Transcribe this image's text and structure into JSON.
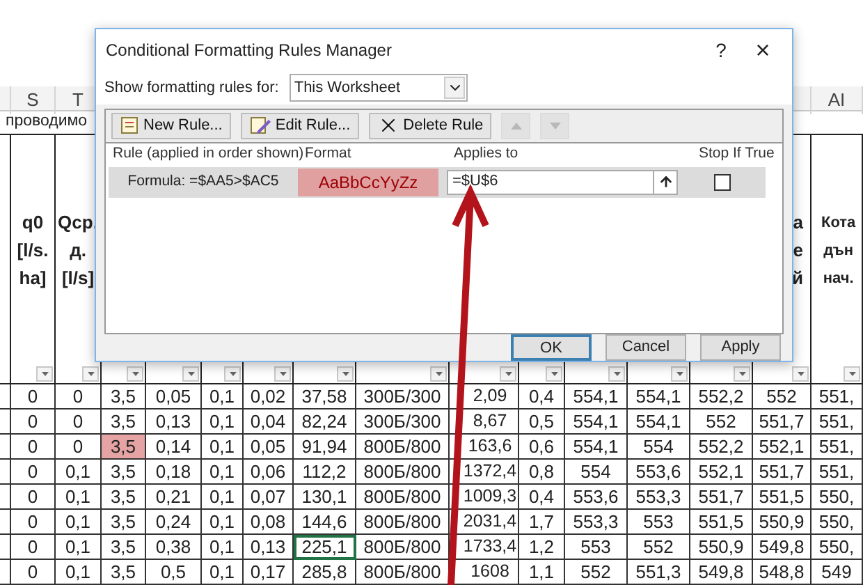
{
  "sheet": {
    "column_letters": [
      "S",
      "T",
      "AI"
    ],
    "row_2_text": "проводимо",
    "header_left": [
      [
        "q0",
        "[l/s.",
        "ha]"
      ],
      [
        "Qср.",
        "д.",
        "[l/s]"
      ]
    ],
    "header_right": [
      [
        "а",
        "е",
        "й"
      ],
      [
        "Кота",
        "дън",
        "нач."
      ]
    ],
    "rows": [
      {
        "cells": [
          "0",
          "0",
          "3,5",
          "0,05",
          "0,1",
          "0,02",
          "37,58",
          "300Б/300",
          "2,09",
          "0,4",
          "554,1",
          "554,1",
          "552,2",
          "552",
          "551,"
        ],
        "highlighted": [
          false,
          false,
          false,
          false,
          false,
          false,
          false,
          false,
          false,
          false,
          false,
          false,
          false,
          false,
          false
        ],
        "selected": [
          false,
          false,
          false,
          false,
          false,
          false,
          false,
          false,
          false,
          false,
          false,
          false,
          false,
          false,
          false
        ]
      },
      {
        "cells": [
          "0",
          "0",
          "3,5",
          "0,13",
          "0,1",
          "0,04",
          "82,24",
          "300Б/300",
          "8,67",
          "0,5",
          "554,1",
          "554,1",
          "552",
          "551,7",
          "551,"
        ],
        "highlighted": [
          false,
          false,
          false,
          false,
          false,
          false,
          false,
          false,
          false,
          false,
          false,
          false,
          false,
          false,
          false
        ],
        "selected": [
          false,
          false,
          false,
          false,
          false,
          false,
          false,
          false,
          false,
          false,
          false,
          false,
          false,
          false,
          false
        ]
      },
      {
        "cells": [
          "0",
          "0",
          "3,5",
          "0,14",
          "0,1",
          "0,05",
          "91,94",
          "800Б/800",
          "163,6",
          "0,6",
          "554,1",
          "554",
          "552,2",
          "552,1",
          "551,"
        ],
        "highlighted": [
          false,
          false,
          true,
          false,
          false,
          false,
          false,
          false,
          false,
          false,
          false,
          false,
          false,
          false,
          false
        ],
        "selected": [
          false,
          false,
          false,
          false,
          false,
          false,
          false,
          false,
          false,
          false,
          false,
          false,
          false,
          false,
          false
        ]
      },
      {
        "cells": [
          "0",
          "0,1",
          "3,5",
          "0,18",
          "0,1",
          "0,06",
          "112,2",
          "800Б/800",
          "1372,4",
          "0,8",
          "554",
          "553,6",
          "552,1",
          "551,7",
          "551,"
        ],
        "highlighted": [
          false,
          false,
          false,
          false,
          false,
          false,
          false,
          false,
          false,
          false,
          false,
          false,
          false,
          false,
          false
        ],
        "selected": [
          false,
          false,
          false,
          false,
          false,
          false,
          false,
          false,
          false,
          false,
          false,
          false,
          false,
          false,
          false
        ]
      },
      {
        "cells": [
          "0",
          "0,1",
          "3,5",
          "0,21",
          "0,1",
          "0,07",
          "130,1",
          "800Б/800",
          "1009,3",
          "0,4",
          "553,6",
          "553,3",
          "551,7",
          "551,5",
          "550,"
        ],
        "highlighted": [
          false,
          false,
          false,
          false,
          false,
          false,
          false,
          false,
          false,
          false,
          false,
          false,
          false,
          false,
          false
        ],
        "selected": [
          false,
          false,
          false,
          false,
          false,
          false,
          false,
          false,
          false,
          false,
          false,
          false,
          false,
          false,
          false
        ]
      },
      {
        "cells": [
          "0",
          "0,1",
          "3,5",
          "0,24",
          "0,1",
          "0,08",
          "144,6",
          "800Б/800",
          "2031,4",
          "1,7",
          "553,3",
          "553",
          "551,5",
          "550,9",
          "550,"
        ],
        "highlighted": [
          false,
          false,
          false,
          false,
          false,
          false,
          false,
          false,
          false,
          false,
          false,
          false,
          false,
          false,
          false
        ],
        "selected": [
          false,
          false,
          false,
          false,
          false,
          false,
          false,
          false,
          false,
          false,
          false,
          false,
          false,
          false,
          false
        ]
      },
      {
        "cells": [
          "0",
          "0,1",
          "3,5",
          "0,38",
          "0,1",
          "0,13",
          "225,1",
          "800Б/800",
          "1733,4",
          "1,2",
          "553",
          "552",
          "550,9",
          "549,8",
          "550,"
        ],
        "highlighted": [
          false,
          false,
          false,
          false,
          false,
          false,
          false,
          false,
          false,
          false,
          false,
          false,
          false,
          false,
          false
        ],
        "selected": [
          false,
          false,
          false,
          false,
          false,
          false,
          true,
          false,
          false,
          false,
          false,
          false,
          false,
          false,
          false
        ]
      },
      {
        "cells": [
          "0",
          "0,1",
          "3,5",
          "0,5",
          "0,1",
          "0,17",
          "285,8",
          "800Б/800",
          "1608",
          "1,1",
          "552",
          "551,3",
          "549,8",
          "548,8",
          "549"
        ],
        "highlighted": [
          false,
          false,
          false,
          false,
          false,
          false,
          false,
          false,
          false,
          false,
          false,
          false,
          false,
          false,
          false
        ],
        "selected": [
          false,
          false,
          false,
          false,
          false,
          false,
          false,
          false,
          false,
          false,
          false,
          false,
          false,
          false,
          false
        ]
      }
    ]
  },
  "dialog": {
    "title": "Conditional Formatting Rules Manager",
    "help": "?",
    "close": "×",
    "show_label": "Show formatting rules for:",
    "show_value": "This Worksheet",
    "toolbar": [
      {
        "kind": "new",
        "label": "New Rule...",
        "disabled": false
      },
      {
        "kind": "edit",
        "label": "Edit Rule...",
        "disabled": false
      },
      {
        "kind": "delete",
        "label": "Delete Rule",
        "disabled": false
      },
      {
        "kind": "up",
        "disabled": true
      },
      {
        "kind": "down",
        "disabled": true
      }
    ],
    "columns": [
      "Rule (applied in order shown)",
      "Format",
      "Applies to",
      "Stop If True"
    ],
    "rules": [
      {
        "rule": "Formula: =$AA5>$AC5",
        "format_preview": "AaBbCcYyZz",
        "applies_to": "=$U$6",
        "stop_if_true": false,
        "selected": true
      }
    ],
    "buttons": [
      {
        "label": "OK",
        "default": true
      },
      {
        "label": "Cancel",
        "default": false
      },
      {
        "label": "Apply",
        "default": false
      }
    ]
  }
}
